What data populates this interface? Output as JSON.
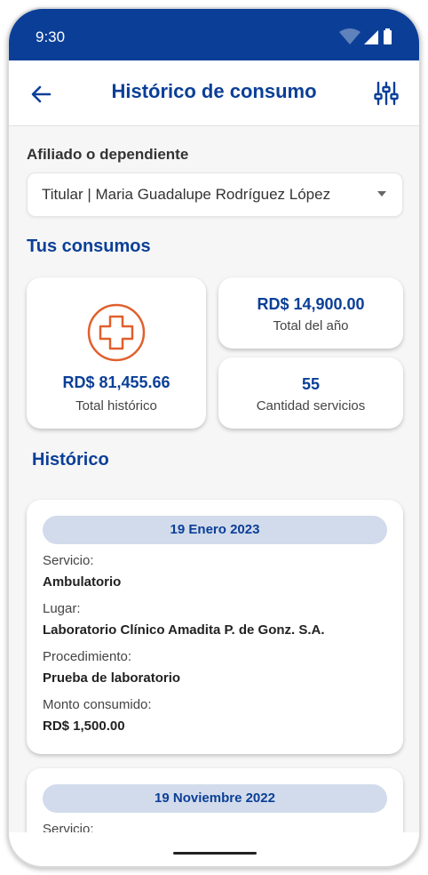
{
  "status_bar": {
    "time": "9:30"
  },
  "app_bar": {
    "title": "Histórico de consumo"
  },
  "affiliate": {
    "label": "Afiliado o dependiente",
    "selected": "Titular | Maria Guadalupe Rodríguez López"
  },
  "consumption": {
    "title": "Tus consumos",
    "total_historic_amount": "RD$ 81,455.66",
    "total_historic_label": "Total histórico",
    "year_amount": "RD$ 14,900.00",
    "year_label": "Total del año",
    "services_count": "55",
    "services_label": "Cantidad servicios"
  },
  "history": {
    "title": "Histórico",
    "items": [
      {
        "date": "19 Enero 2023",
        "service_label": "Servicio:",
        "service": "Ambulatorio",
        "place_label": "Lugar:",
        "place": "Laboratorio Clínico Amadita P. de Gonz. S.A.",
        "procedure_label": "Procedimiento:",
        "procedure": "Prueba de laboratorio",
        "amount_label": "Monto consumido:",
        "amount": "RD$ 1,500.00"
      },
      {
        "date": "19 Noviembre 2022",
        "service_label": "Servicio:"
      }
    ]
  },
  "colors": {
    "primary": "#0b3f97",
    "accent": "#e0602e",
    "pill": "#d2dbeb"
  },
  "icons": [
    "back-arrow-icon",
    "filter-sliders-icon",
    "medical-cross-icon",
    "dropdown-caret-icon"
  ]
}
